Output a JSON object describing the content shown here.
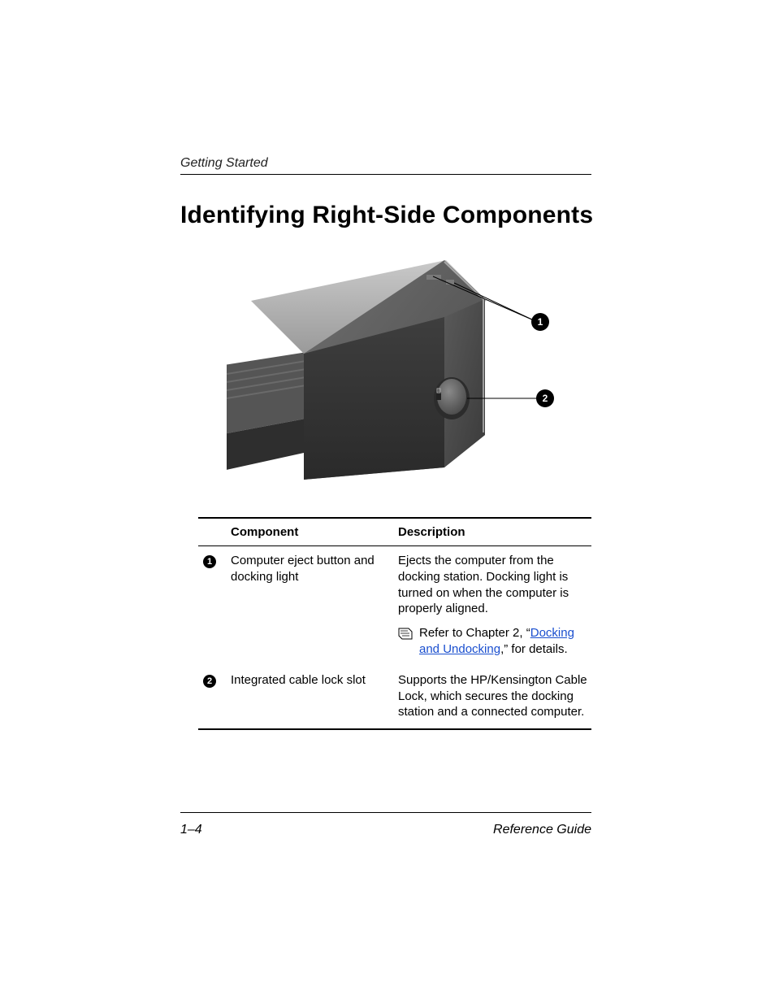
{
  "header": {
    "running_head": "Getting Started"
  },
  "title": "Identifying Right-Side Components",
  "illustration": {
    "callouts": [
      "1",
      "2"
    ]
  },
  "table": {
    "head": {
      "component": "Component",
      "description": "Description"
    },
    "rows": [
      {
        "num": "1",
        "component": "Computer eject button and docking light",
        "description": "Ejects the computer from the docking station. Docking light is turned on when the computer is properly aligned.",
        "note_pre": "Refer to Chapter 2, “",
        "note_link": "Docking and Undocking",
        "note_post": ",” for details."
      },
      {
        "num": "2",
        "component": "Integrated cable lock slot",
        "description": "Supports the HP/Kensington Cable Lock, which secures the docking station and a connected computer."
      }
    ]
  },
  "footer": {
    "page": "1–4",
    "book": "Reference Guide"
  }
}
